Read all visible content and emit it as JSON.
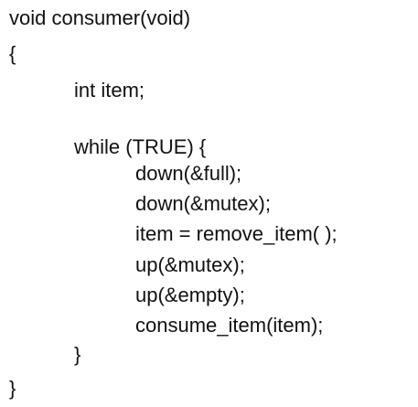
{
  "code_lines": [
    "void consumer(void)",
    "{",
    "int item;",
    "while (TRUE) {",
    "down(&full);",
    "down(&mutex);",
    "item = remove_item( );",
    "up(&mutex);",
    "up(&empty);",
    "consume_item(item);",
    "}",
    "}"
  ]
}
